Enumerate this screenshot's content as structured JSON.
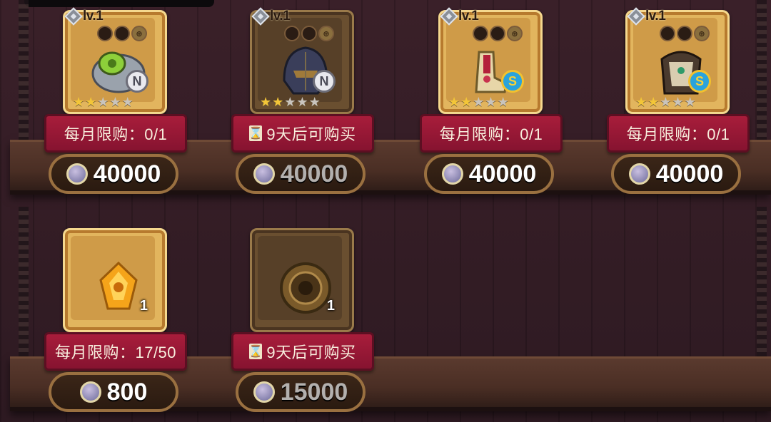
{
  "header": {
    "bar_visible": true
  },
  "icons": {
    "currency": "coin-icon",
    "timer": "hourglass-icon",
    "level": "diamond-level-icon"
  },
  "colors": {
    "ribbon": "#a81d3b",
    "frame_gold": "#e2b55e",
    "frame_dark": "#6a4f30"
  },
  "items": [
    {
      "name": "bracer",
      "level_label": "lv.1",
      "grade": "N",
      "stars_on": 2,
      "stars_total": 5,
      "ribbon_text": "每月限购：0/1",
      "timed": false,
      "price": "40000",
      "purchasable": true,
      "quantity": ""
    },
    {
      "name": "helmet",
      "level_label": "lv.1",
      "grade": "N",
      "stars_on": 2,
      "stars_total": 5,
      "ribbon_text": "9天后可购买",
      "timed": true,
      "price": "40000",
      "purchasable": false,
      "quantity": ""
    },
    {
      "name": "boots",
      "level_label": "lv.1",
      "grade": "S",
      "stars_on": 2,
      "stars_total": 5,
      "ribbon_text": "每月限购：0/1",
      "timed": false,
      "price": "40000",
      "purchasable": true,
      "quantity": ""
    },
    {
      "name": "armor",
      "level_label": "lv.1",
      "grade": "S",
      "stars_on": 2,
      "stars_total": 5,
      "ribbon_text": "每月限购：0/1",
      "timed": false,
      "price": "40000",
      "purchasable": true,
      "quantity": ""
    },
    {
      "name": "gem",
      "level_label": "",
      "grade": "",
      "stars_on": 0,
      "stars_total": 0,
      "ribbon_text": "每月限购：17/50",
      "timed": false,
      "price": "800",
      "purchasable": true,
      "quantity": "1"
    },
    {
      "name": "medallion",
      "level_label": "",
      "grade": "",
      "stars_on": 0,
      "stars_total": 0,
      "ribbon_text": "9天后可购买",
      "timed": true,
      "price": "15000",
      "purchasable": false,
      "quantity": "1"
    }
  ]
}
